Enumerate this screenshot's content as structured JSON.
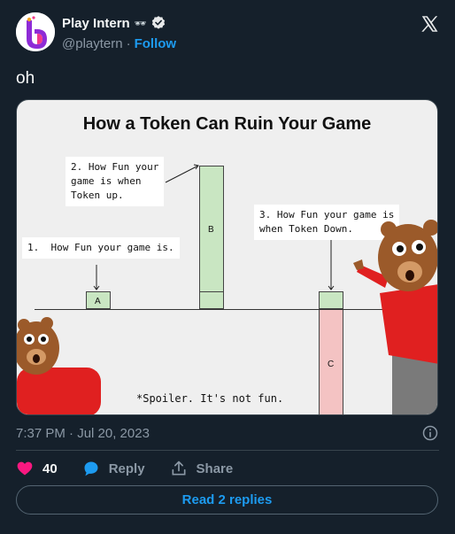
{
  "header": {
    "display_name": "Play Intern",
    "emoji": "🕶",
    "handle": "@playtern",
    "separator": "·",
    "follow_label": "Follow"
  },
  "tweet": {
    "text": "oh",
    "timestamp": "7:37 PM · Jul 20, 2023"
  },
  "media": {
    "title": "How a Token Can Ruin Your Game",
    "note_1": "1.  How Fun your game is.",
    "note_2": "2. How Fun your\ngame is when\nToken up.",
    "note_3": "3. How Fun your game is\nwhen Token Down.",
    "spoiler": "*Spoiler. It's not fun.",
    "bar_a": "A",
    "bar_b": "B",
    "bar_c": "C"
  },
  "actions": {
    "like_count": "40",
    "reply_label": "Reply",
    "share_label": "Share"
  },
  "replies_button": "Read 2 replies",
  "colors": {
    "background": "#15202b",
    "accent": "#1d9bf0",
    "like": "#f91880",
    "muted": "#8b98a5"
  }
}
